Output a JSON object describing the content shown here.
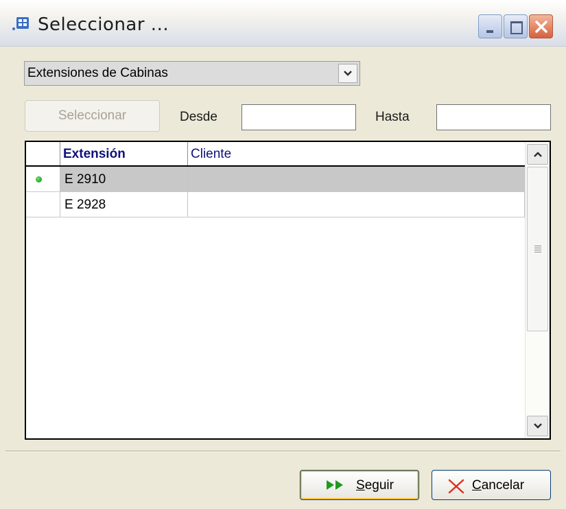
{
  "window": {
    "title": "Seleccionar ...",
    "controls": [
      "minimize",
      "maximize",
      "close"
    ]
  },
  "dropdown": {
    "selected": "Extensiones de Cabinas"
  },
  "filter": {
    "select_button": "Seleccionar",
    "from_label": "Desde",
    "from_value": "",
    "to_label": "Hasta",
    "to_value": ""
  },
  "grid": {
    "columns": [
      "Extensión",
      "Cliente"
    ],
    "rows": [
      {
        "extension": "E 2910",
        "cliente": "",
        "selected": true
      },
      {
        "extension": "E 2928",
        "cliente": "",
        "selected": false
      }
    ]
  },
  "footer": {
    "continue_label": "Seguir",
    "cancel_label": "Cancelar"
  },
  "colors": {
    "header_text": "#10107a",
    "selected_row": "#c8c8c8",
    "indicator": "#0a8a0a",
    "cancel_icon": "#e0301e",
    "continue_icon": "#1f9a1f"
  }
}
